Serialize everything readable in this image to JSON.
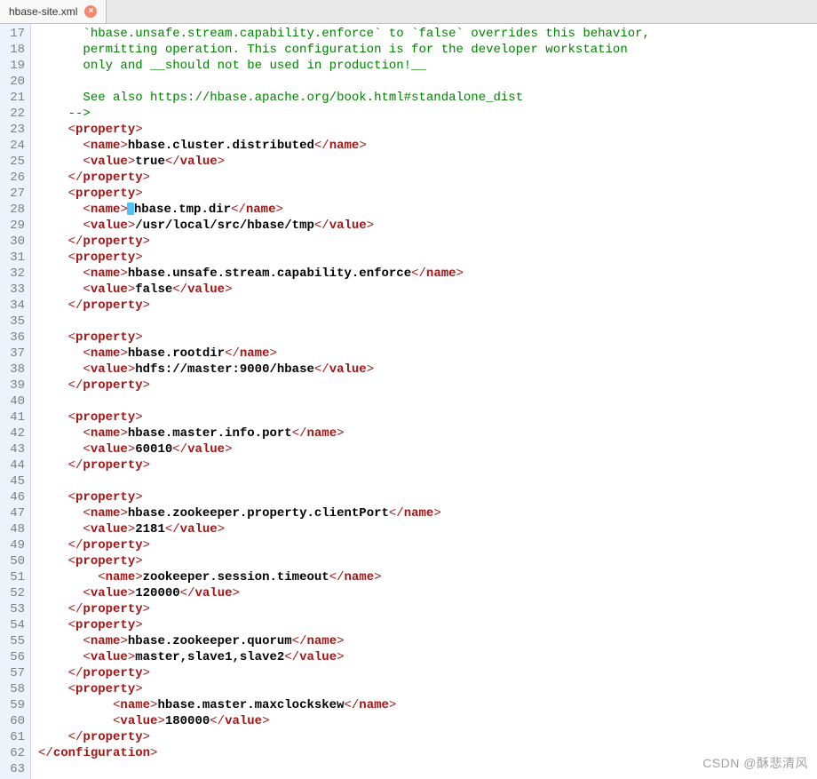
{
  "tab": {
    "filename": "hbase-site.xml",
    "close_glyph": "×"
  },
  "watermark": "CSDN @酥悲清风",
  "gutter_start": 17,
  "lines": [
    {
      "n": 17,
      "kind": "comment",
      "indent": 6,
      "text": "`hbase.unsafe.stream.capability.enforce` to `false` overrides this behavior,"
    },
    {
      "n": 18,
      "kind": "comment",
      "indent": 6,
      "text": "permitting operation. This configuration is for the developer workstation"
    },
    {
      "n": 19,
      "kind": "comment",
      "indent": 6,
      "text": "only and __should not be used in production!__"
    },
    {
      "n": 20,
      "kind": "blank"
    },
    {
      "n": 21,
      "kind": "comment",
      "indent": 6,
      "text": "See also https://hbase.apache.org/book.html#standalone_dist"
    },
    {
      "n": 22,
      "kind": "comment",
      "indent": 4,
      "text": "-->"
    },
    {
      "n": 23,
      "kind": "open",
      "indent": 4,
      "tag": "property"
    },
    {
      "n": 24,
      "kind": "pair",
      "indent": 6,
      "tag": "name",
      "content": "hbase.cluster.distributed"
    },
    {
      "n": 25,
      "kind": "pair",
      "indent": 6,
      "tag": "value",
      "content": "true"
    },
    {
      "n": 26,
      "kind": "close",
      "indent": 4,
      "tag": "property"
    },
    {
      "n": 27,
      "kind": "open",
      "indent": 4,
      "tag": "property"
    },
    {
      "n": 28,
      "kind": "pair",
      "indent": 6,
      "tag": "name",
      "content": "hbase.tmp.dir",
      "caret": true
    },
    {
      "n": 29,
      "kind": "pair",
      "indent": 6,
      "tag": "value",
      "content": "/usr/local/src/hbase/tmp"
    },
    {
      "n": 30,
      "kind": "close",
      "indent": 4,
      "tag": "property"
    },
    {
      "n": 31,
      "kind": "open",
      "indent": 4,
      "tag": "property"
    },
    {
      "n": 32,
      "kind": "pair",
      "indent": 6,
      "tag": "name",
      "content": "hbase.unsafe.stream.capability.enforce"
    },
    {
      "n": 33,
      "kind": "pair",
      "indent": 6,
      "tag": "value",
      "content": "false"
    },
    {
      "n": 34,
      "kind": "close",
      "indent": 4,
      "tag": "property"
    },
    {
      "n": 35,
      "kind": "blank"
    },
    {
      "n": 36,
      "kind": "open",
      "indent": 4,
      "tag": "property"
    },
    {
      "n": 37,
      "kind": "pair",
      "indent": 6,
      "tag": "name",
      "content": "hbase.rootdir"
    },
    {
      "n": 38,
      "kind": "pair",
      "indent": 6,
      "tag": "value",
      "content": "hdfs://master:9000/hbase"
    },
    {
      "n": 39,
      "kind": "close",
      "indent": 4,
      "tag": "property"
    },
    {
      "n": 40,
      "kind": "blank"
    },
    {
      "n": 41,
      "kind": "open",
      "indent": 4,
      "tag": "property"
    },
    {
      "n": 42,
      "kind": "pair",
      "indent": 6,
      "tag": "name",
      "content": "hbase.master.info.port"
    },
    {
      "n": 43,
      "kind": "pair",
      "indent": 6,
      "tag": "value",
      "content": "60010"
    },
    {
      "n": 44,
      "kind": "close",
      "indent": 4,
      "tag": "property"
    },
    {
      "n": 45,
      "kind": "blank"
    },
    {
      "n": 46,
      "kind": "open",
      "indent": 4,
      "tag": "property"
    },
    {
      "n": 47,
      "kind": "pair",
      "indent": 6,
      "tag": "name",
      "content": "hbase.zookeeper.property.clientPort"
    },
    {
      "n": 48,
      "kind": "pair",
      "indent": 6,
      "tag": "value",
      "content": "2181"
    },
    {
      "n": 49,
      "kind": "close",
      "indent": 4,
      "tag": "property"
    },
    {
      "n": 50,
      "kind": "open",
      "indent": 4,
      "tag": "property"
    },
    {
      "n": 51,
      "kind": "pair",
      "indent": 8,
      "tag": "name",
      "content": "zookeeper.session.timeout"
    },
    {
      "n": 52,
      "kind": "pair",
      "indent": 6,
      "tag": "value",
      "content": "120000"
    },
    {
      "n": 53,
      "kind": "close",
      "indent": 4,
      "tag": "property"
    },
    {
      "n": 54,
      "kind": "open",
      "indent": 4,
      "tag": "property"
    },
    {
      "n": 55,
      "kind": "pair",
      "indent": 6,
      "tag": "name",
      "content": "hbase.zookeeper.quorum"
    },
    {
      "n": 56,
      "kind": "pair",
      "indent": 6,
      "tag": "value",
      "content": "master,slave1,slave2"
    },
    {
      "n": 57,
      "kind": "close",
      "indent": 4,
      "tag": "property"
    },
    {
      "n": 58,
      "kind": "open",
      "indent": 4,
      "tag": "property"
    },
    {
      "n": 59,
      "kind": "pair",
      "indent": 10,
      "tag": "name",
      "content": "hbase.master.maxclockskew"
    },
    {
      "n": 60,
      "kind": "pair",
      "indent": 10,
      "tag": "value",
      "content": "180000"
    },
    {
      "n": 61,
      "kind": "close",
      "indent": 4,
      "tag": "property"
    },
    {
      "n": 62,
      "kind": "close",
      "indent": 0,
      "tag": "configuration"
    },
    {
      "n": 63,
      "kind": "blank"
    }
  ]
}
